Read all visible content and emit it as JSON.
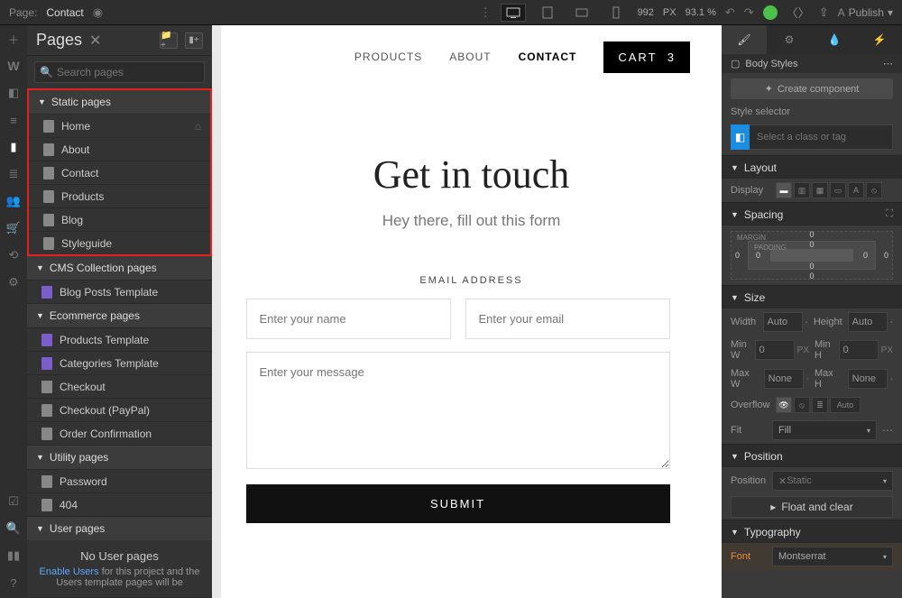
{
  "topbar": {
    "page_label": "Page:",
    "page_name": "Contact",
    "width": "992",
    "px": "PX",
    "zoom": "93.1 %",
    "publish": "Publish"
  },
  "pages_panel": {
    "title": "Pages",
    "search_placeholder": "Search pages",
    "groups": {
      "static": {
        "label": "Static pages"
      },
      "cms": {
        "label": "CMS Collection pages"
      },
      "ecom": {
        "label": "Ecommerce pages"
      },
      "utility": {
        "label": "Utility pages"
      },
      "user": {
        "label": "User pages"
      }
    },
    "static_items": [
      {
        "label": "Home",
        "home": true
      },
      {
        "label": "About"
      },
      {
        "label": "Contact"
      },
      {
        "label": "Products"
      },
      {
        "label": "Blog"
      },
      {
        "label": "Styleguide"
      }
    ],
    "cms_items": [
      {
        "label": "Blog Posts Template",
        "purple": true
      }
    ],
    "ecom_items": [
      {
        "label": "Products Template",
        "purple": true
      },
      {
        "label": "Categories Template",
        "purple": true
      },
      {
        "label": "Checkout"
      },
      {
        "label": "Checkout (PayPal)"
      },
      {
        "label": "Order Confirmation"
      }
    ],
    "utility_items": [
      {
        "label": "Password"
      },
      {
        "label": "404"
      }
    ],
    "no_user": {
      "title": "No User pages",
      "link": "Enable Users",
      "rest": " for this project and the Users template pages will be"
    }
  },
  "site": {
    "nav": {
      "products": "PRODUCTS",
      "about": "ABOUT",
      "contact": "CONTACT",
      "cart": "CART",
      "cart_qty": "3"
    },
    "hero": {
      "title": "Get in touch",
      "sub": "Hey there, fill out this form"
    },
    "form": {
      "email_label": "EMAIL ADDRESS",
      "name_ph": "Enter your name",
      "email_ph": "Enter your email",
      "msg_ph": "Enter your message",
      "submit": "SUBMIT"
    }
  },
  "right": {
    "body_styles": "Body Styles",
    "create": "Create component",
    "selector_lbl": "Style selector",
    "selector_ph": "Select a class or tag",
    "sections": {
      "layout": "Layout",
      "spacing": "Spacing",
      "size": "Size",
      "position": "Position",
      "typography": "Typography"
    },
    "display": "Display",
    "margin": "MARGIN",
    "padding": "PADDING",
    "zero": "0",
    "size": {
      "width": "Width",
      "width_v": "Auto",
      "height": "Height",
      "height_v": "Auto",
      "minw": "Min W",
      "minw_v": "0",
      "minw_u": "PX",
      "minh": "Min H",
      "minh_v": "0",
      "minh_u": "PX",
      "maxw": "Max W",
      "maxw_v": "None",
      "maxh": "Max H",
      "maxh_v": "None"
    },
    "overflow": "Overflow",
    "auto": "Auto",
    "fit": "Fit",
    "fit_v": "Fill",
    "position": "Position",
    "position_v": "Static",
    "float": "Float and clear",
    "font": "Font",
    "font_v": "Montserrat"
  }
}
